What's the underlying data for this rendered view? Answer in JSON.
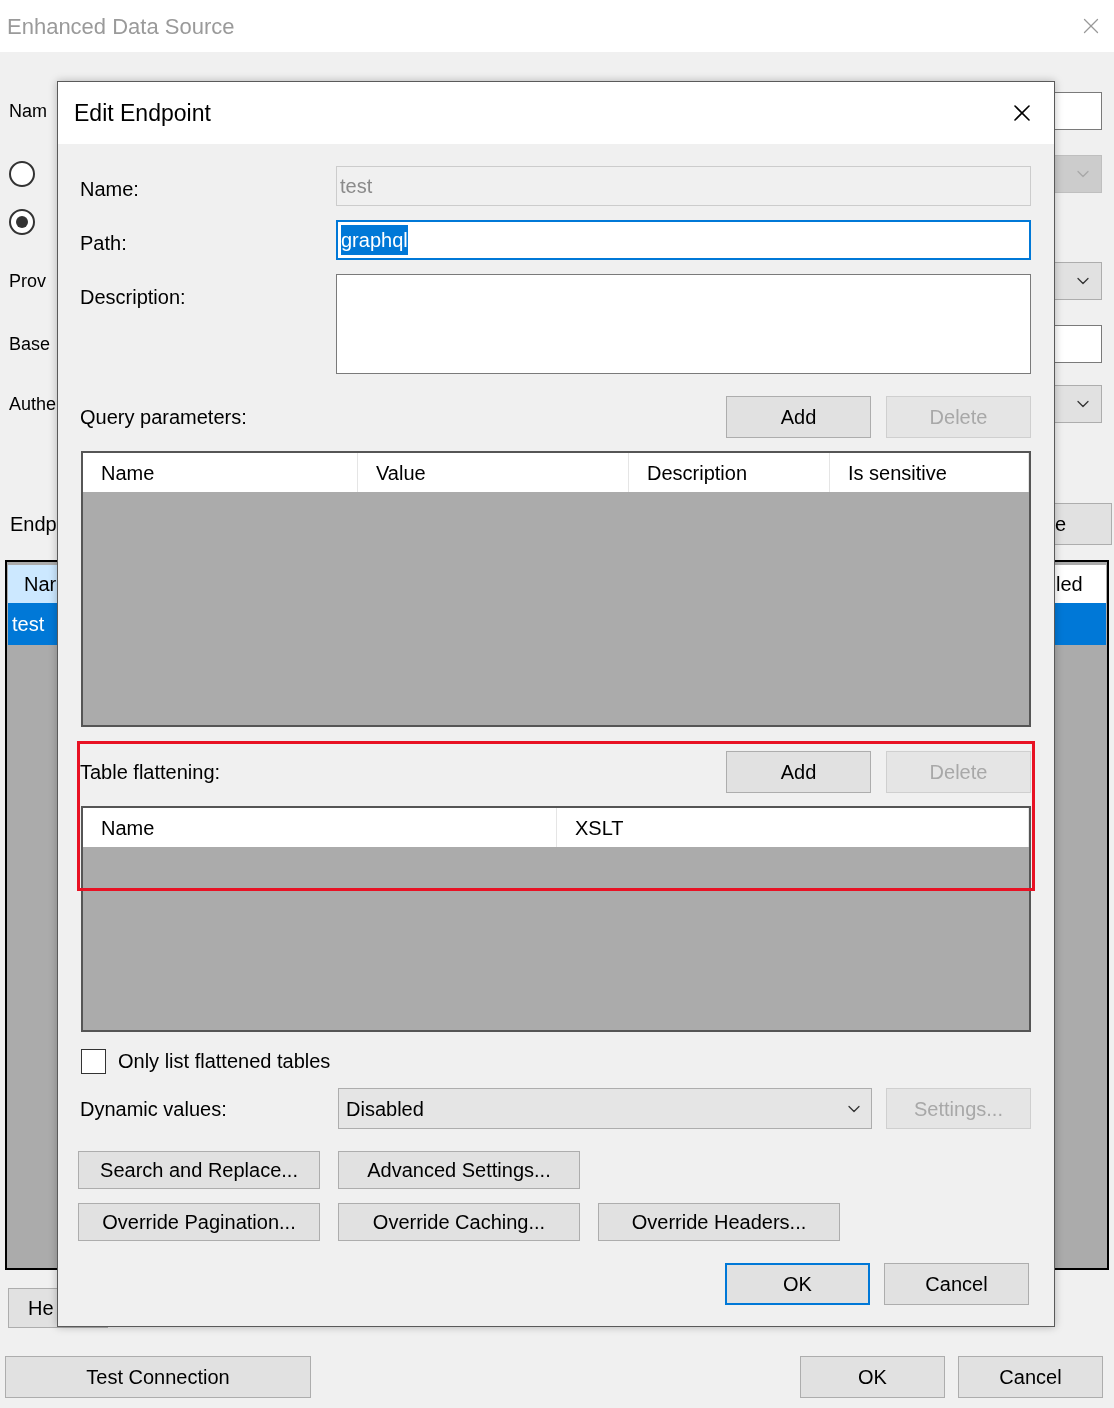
{
  "window": {
    "title": "Enhanced Data Source"
  },
  "background": {
    "rows": [
      {
        "kind": "field",
        "label": "Nam",
        "field": {
          "kind": "input"
        }
      },
      {
        "kind": "radio",
        "selected": false,
        "field": {
          "kind": "combo",
          "disabled": true
        }
      },
      {
        "kind": "radio",
        "selected": true
      },
      {
        "kind": "field",
        "label": "Prov",
        "field": {
          "kind": "combo",
          "disabled": false
        }
      },
      {
        "kind": "field",
        "label": "Base",
        "field": {
          "kind": "input"
        }
      },
      {
        "kind": "field",
        "label": "Authe",
        "field": {
          "kind": "combo",
          "disabled": false
        }
      }
    ],
    "endpoints_label": "Endp",
    "endpoint_button": "e",
    "endpoints_table": {
      "columns": [
        "Nar",
        "led"
      ],
      "rows": [
        {
          "cells": [
            "test"
          ],
          "selected": true
        }
      ]
    },
    "help_button": "He",
    "buttons": [
      "Test Connection",
      "OK",
      "Cancel"
    ]
  },
  "dialog": {
    "title": "Edit Endpoint",
    "fields": [
      {
        "kind": "text",
        "label": "Name:",
        "value": "test",
        "disabled": true,
        "text_selected": false
      },
      {
        "kind": "text",
        "label": "Path:",
        "value": "graphql",
        "disabled": false,
        "text_selected": true
      },
      {
        "kind": "multiline",
        "label": "Description:",
        "disabled": false,
        "text_selected": false
      }
    ],
    "query_parameters": {
      "label": "Query parameters:",
      "buttons": [
        {
          "label": "Add",
          "disabled": false
        },
        {
          "label": "Delete",
          "disabled": true
        }
      ],
      "columns": [
        "Name",
        "Value",
        "Description",
        "Is sensitive"
      ]
    },
    "table_flattening": {
      "label": "Table flattening:",
      "highlighted": true,
      "buttons": [
        {
          "label": "Add",
          "disabled": false
        },
        {
          "label": "Delete",
          "disabled": true
        }
      ],
      "columns": [
        "Name",
        "XSLT"
      ]
    },
    "only_list_flattened": {
      "label": "Only list flattened tables",
      "checked": false
    },
    "dynamic_values": {
      "label": "Dynamic values:",
      "value": "Disabled",
      "settings_button": {
        "label": "Settings...",
        "disabled": true
      }
    },
    "action_rows": [
      {
        "buttons": [
          "Search and Replace...",
          "Advanced Settings..."
        ]
      },
      {
        "buttons": [
          "Override Pagination...",
          "Override Caching...",
          "Override Headers..."
        ]
      }
    ],
    "footer_buttons": [
      {
        "label": "OK",
        "default": true
      },
      {
        "label": "Cancel",
        "default": false
      }
    ]
  }
}
